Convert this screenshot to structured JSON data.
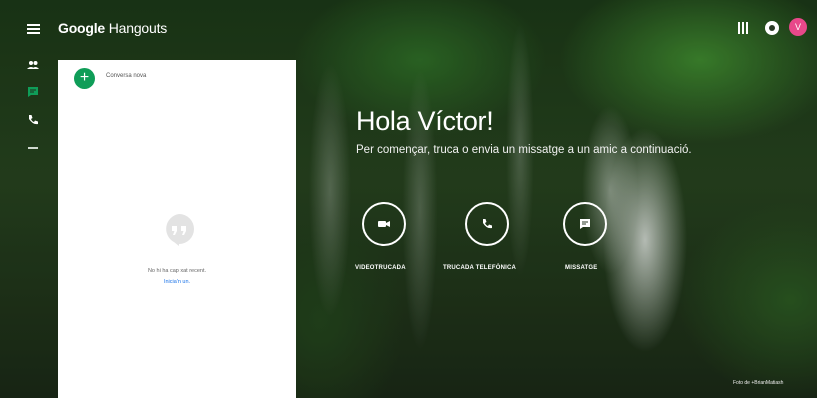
{
  "header": {
    "title_brand": "Google",
    "title_product": "Hangouts",
    "avatar_letter": "V"
  },
  "panel": {
    "new_conversation_label": "Conversa nova",
    "empty_message": "No hi ha cap xat recent.",
    "empty_link": "Inicia'n un."
  },
  "main": {
    "greeting": "Hola Víctor!",
    "subtitle": "Per començar, truca o envia un missatge a un amic a continuació.",
    "actions": [
      {
        "label": "VIDEOTRUCADA",
        "icon": "video-camera-icon"
      },
      {
        "label": "TRUCADA TELEFÒNICA",
        "icon": "phone-icon"
      },
      {
        "label": "MISSATGE",
        "icon": "message-icon"
      }
    ]
  },
  "photo_credit": "Foto de +BrianMatiash",
  "colors": {
    "accent_green": "#0f9d58",
    "avatar": "#e8488a",
    "link": "#1a73e8"
  }
}
